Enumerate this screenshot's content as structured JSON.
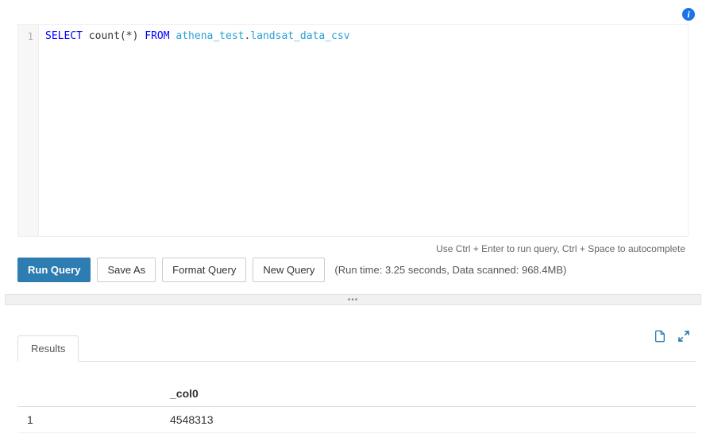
{
  "editor": {
    "line_number": "1",
    "sql": {
      "kw_select": "SELECT",
      "func": " count(*) ",
      "kw_from": "FROM",
      "sp1": " ",
      "schema": "athena_test",
      "dot": ".",
      "table": "landsat_data_csv"
    }
  },
  "hint": "Use Ctrl + Enter to run query, Ctrl + Space to autocomplete",
  "toolbar": {
    "run": "Run Query",
    "save_as": "Save As",
    "format": "Format Query",
    "new_query": "New Query",
    "status": "(Run time: 3.25 seconds, Data scanned: 968.4MB)"
  },
  "divider": "•••",
  "results": {
    "tab_label": "Results",
    "columns": {
      "rownum": "",
      "col0": "_col0"
    },
    "row": {
      "rownum": "1",
      "col0": "4548313"
    }
  }
}
